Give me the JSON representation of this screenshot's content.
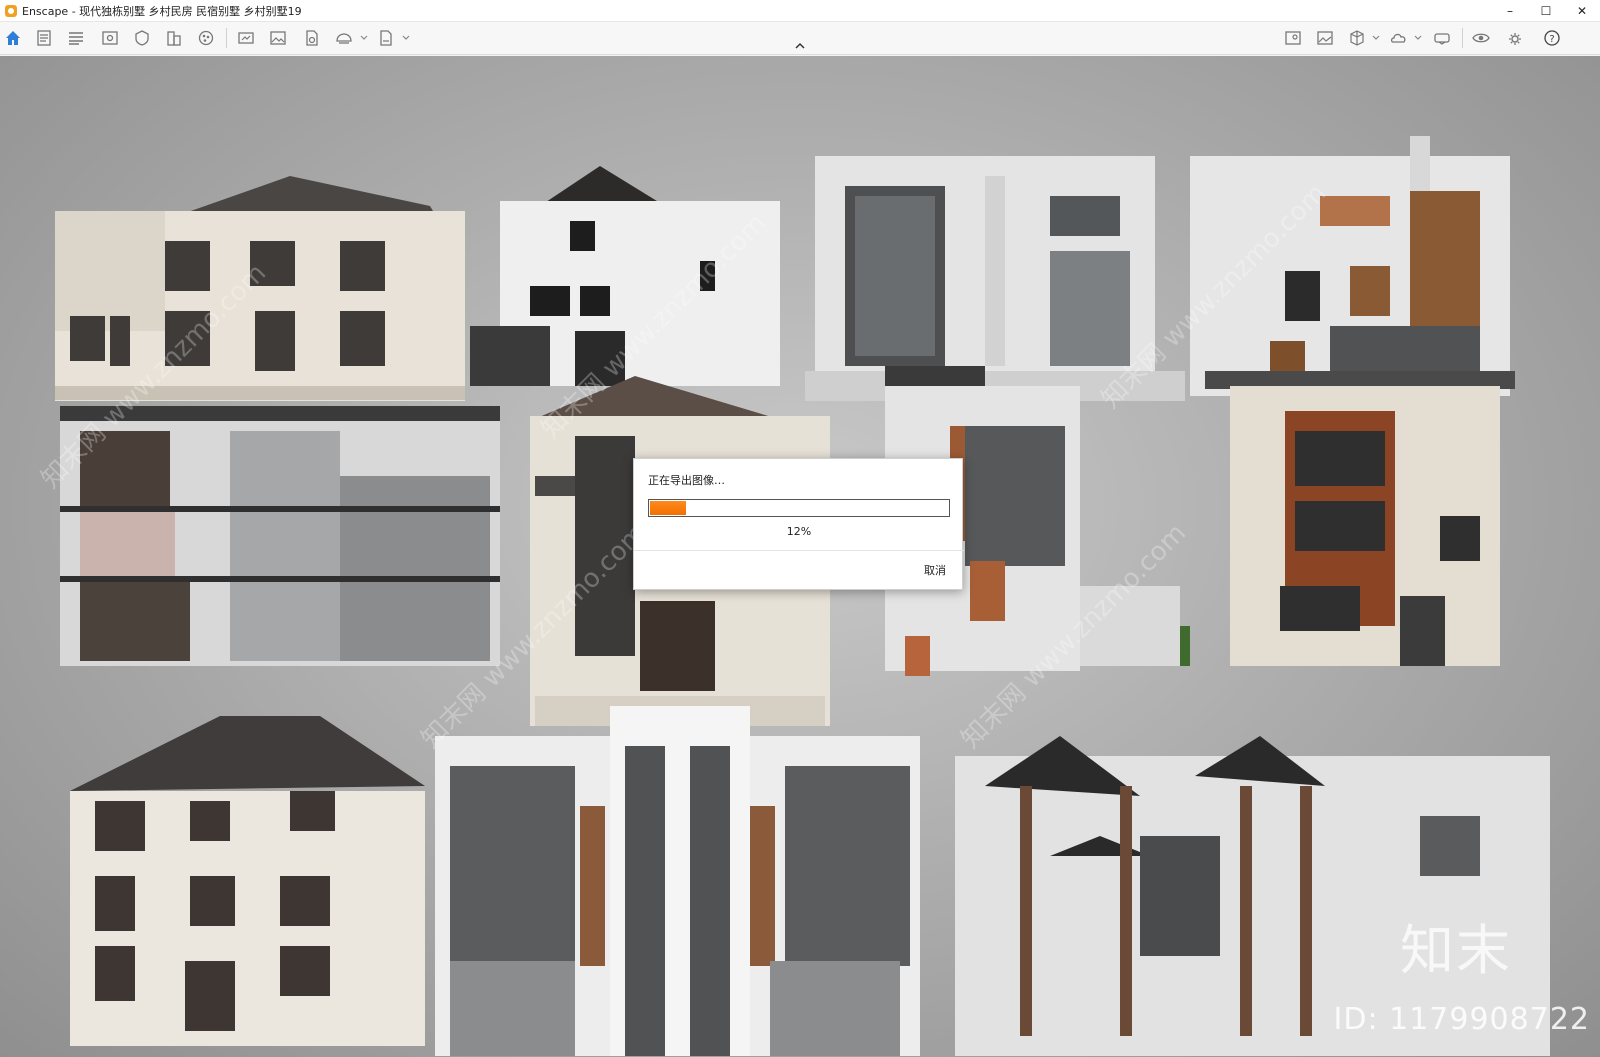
{
  "window": {
    "title": "Enscape - 现代独栋别墅 乡村民房 民宿别墅 乡村别墅19",
    "controls": {
      "minimize": "–",
      "maximize": "☐",
      "close": "✕"
    }
  },
  "toolbar": {
    "left_icons": [
      "home-icon",
      "project-icon",
      "layers-icon",
      "view-icon",
      "asset-icon",
      "building-icon",
      "material-icon",
      "screenshot-icon",
      "image-icon",
      "doc-icon",
      "batch-icon",
      "export-icon"
    ],
    "right_icons": [
      "map-icon",
      "gallery-icon",
      "cube-icon",
      "cloud-icon",
      "vr-icon",
      "eye-icon",
      "settings-icon",
      "help-icon"
    ],
    "accent": "#2f7fd8"
  },
  "dialog": {
    "title": "正在导出图像…",
    "progress": 0.12,
    "progress_label": "12%",
    "cancel_label": "取消",
    "progress_color": "#f57c00"
  },
  "viewport": {
    "watermark_logo": "知末",
    "watermark_id": "ID: 1179908722",
    "diagonal_watermark": "知末网 www.znzmo.com"
  }
}
